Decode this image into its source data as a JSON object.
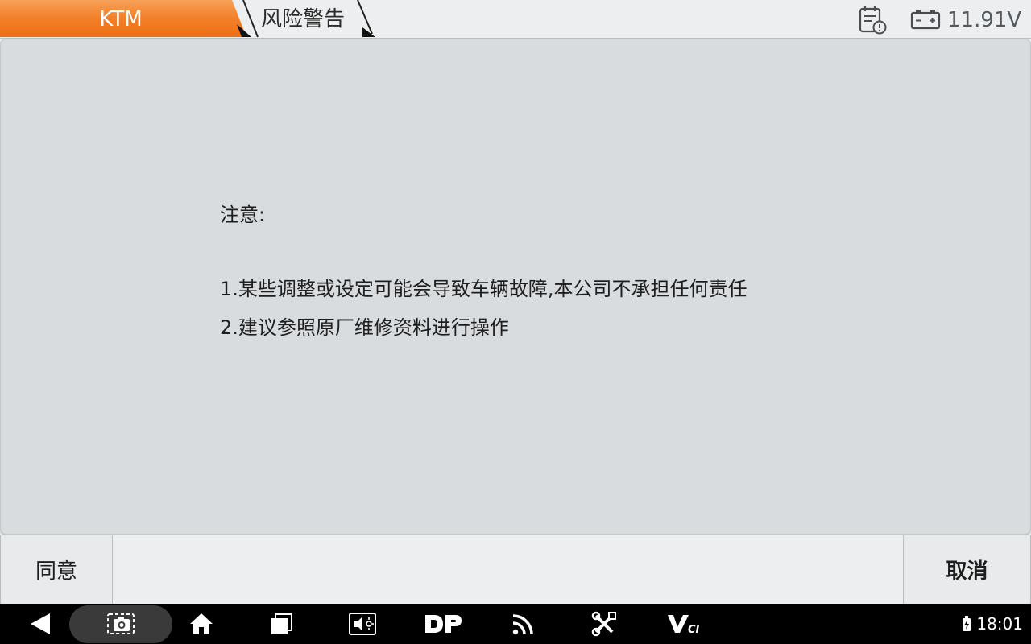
{
  "header": {
    "brand_crumb": "KTM",
    "current_crumb": "风险警告",
    "voltage": "11.91V",
    "icons": [
      "report-icon",
      "battery-icon"
    ]
  },
  "content": {
    "title": "注意:",
    "line1": "1.某些调整或设定可能会导致车辆故障,本公司不承担任何责任",
    "line2": "2.建议参照原厂维修资料进行操作"
  },
  "actions": {
    "agree_label": "同意",
    "cancel_label": "取消"
  },
  "navbar": {
    "icons": [
      "back-icon",
      "screenshot-icon",
      "home-icon",
      "recent-apps-icon",
      "screen-mirror-icon",
      "dp-icon",
      "wifi-feed-icon",
      "tools-icon",
      "vci-icon"
    ],
    "vci_label": "VCI",
    "dp_label": "DP",
    "time": "18:01"
  },
  "colors": {
    "accent": "#f07a22",
    "panel_bg": "#d8dcdf",
    "topbar_bg": "#eceeef",
    "navbar_bg": "#000000"
  }
}
